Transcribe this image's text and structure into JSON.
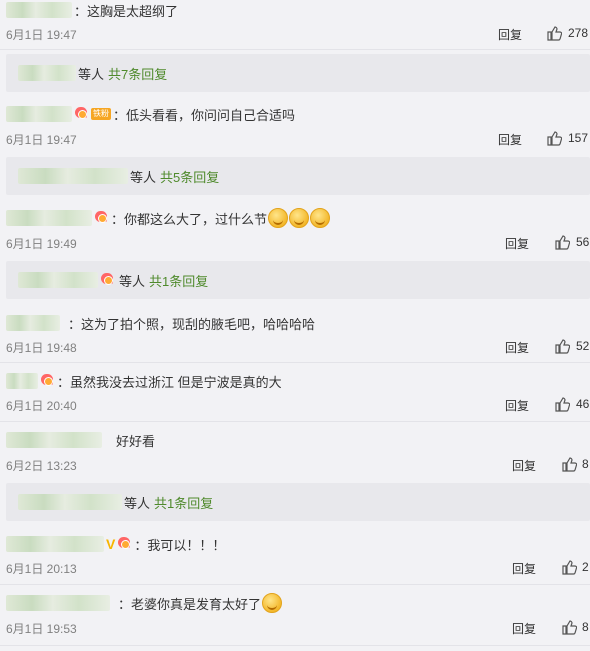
{
  "comments": [
    {
      "text": "这胸是太超纲了",
      "time": "6月1日 19:47",
      "reply": "回复",
      "likes": "278"
    },
    {
      "text": "低头看看，你问问自己合适吗",
      "time": "6月1日 19:47",
      "reply": "回复",
      "likes": "157",
      "fan_tag": "铁粉"
    },
    {
      "text": "你都这么大了，过什么节",
      "time": "6月1日 19:49",
      "reply": "回复",
      "likes": "56"
    },
    {
      "text": "这为了拍个照，现刮的腋毛吧，哈哈哈哈",
      "time": "6月1日 19:48",
      "reply": "回复",
      "likes": "52"
    },
    {
      "text": "虽然我没去过浙江 但是宁波是真的大",
      "time": "6月1日 20:40",
      "reply": "回复",
      "likes": "46"
    },
    {
      "text": "好好看",
      "time": "6月2日 13:23",
      "reply": "回复",
      "likes": "8"
    },
    {
      "text": "我可以！！！",
      "time": "6月1日 20:13",
      "reply": "回复",
      "likes": "2"
    },
    {
      "text": "老婆你真是发育太好了",
      "time": "6月1日 19:53",
      "reply": "回复",
      "likes": "8"
    }
  ],
  "reply_summaries": [
    {
      "who": "等人",
      "more": "共7条回复"
    },
    {
      "who": "等人",
      "more": "共5条回复"
    },
    {
      "who": "等人",
      "more": "共1条回复"
    },
    {
      "who": "等人",
      "more": "共1条回复"
    }
  ],
  "icons": {
    "like": "thumbs-up-icon",
    "badge": "fan-badge-icon",
    "emoji": "smile-emoji-icon"
  },
  "colors": {
    "link_green": "#4f8a2c",
    "meta_gray": "#808080",
    "background": "#f2f2f5"
  }
}
